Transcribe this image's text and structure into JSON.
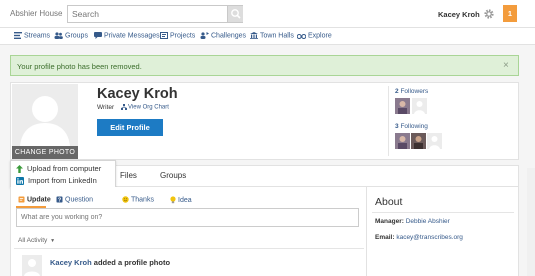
{
  "header": {
    "brand": "Abshier House",
    "search_placeholder": "Search",
    "user_name": "Kacey Kroh",
    "notification_count": "1"
  },
  "nav": {
    "items": [
      {
        "label": "Streams",
        "icon": "streams-icon"
      },
      {
        "label": "Groups",
        "icon": "groups-icon"
      },
      {
        "label": "Private Messages",
        "icon": "messages-icon"
      },
      {
        "label": "Projects",
        "icon": "projects-icon"
      },
      {
        "label": "Challenges",
        "icon": "challenges-icon"
      },
      {
        "label": "Town Halls",
        "icon": "townhalls-icon"
      },
      {
        "label": "Explore",
        "icon": "explore-icon"
      }
    ]
  },
  "alert": {
    "message": "Your profile photo has been removed.",
    "close": "×"
  },
  "profile": {
    "name": "Kacey Kroh",
    "role": "Writer",
    "org_chart": "View Org Chart",
    "edit_button": "Edit Profile",
    "change_photo": "CHANGE PHOTO",
    "followers_count": "2",
    "followers_label": "Followers",
    "following_count": "3",
    "following_label": "Following"
  },
  "photo_menu": {
    "items": [
      "Upload from computer",
      "Import from LinkedIn"
    ]
  },
  "tabs": [
    "Files",
    "Groups"
  ],
  "composer": {
    "tabs": [
      "Update",
      "Question",
      "Thanks",
      "Idea"
    ],
    "placeholder": "What are you working on?"
  },
  "feed": {
    "filter_label": "All Activity",
    "activity": {
      "user": "Kacey Kroh",
      "action": "added a profile photo"
    }
  },
  "about": {
    "title": "About",
    "manager_label": "Manager:",
    "manager_value": "Debbie Abshier",
    "email_label": "Email:",
    "email_value": "kacey@transcribes.org"
  },
  "colors": {
    "accent_orange": "#f39c3d",
    "link_blue": "#365a8a",
    "button_blue": "#1d7bc4",
    "success_bg": "#dff0d8"
  }
}
